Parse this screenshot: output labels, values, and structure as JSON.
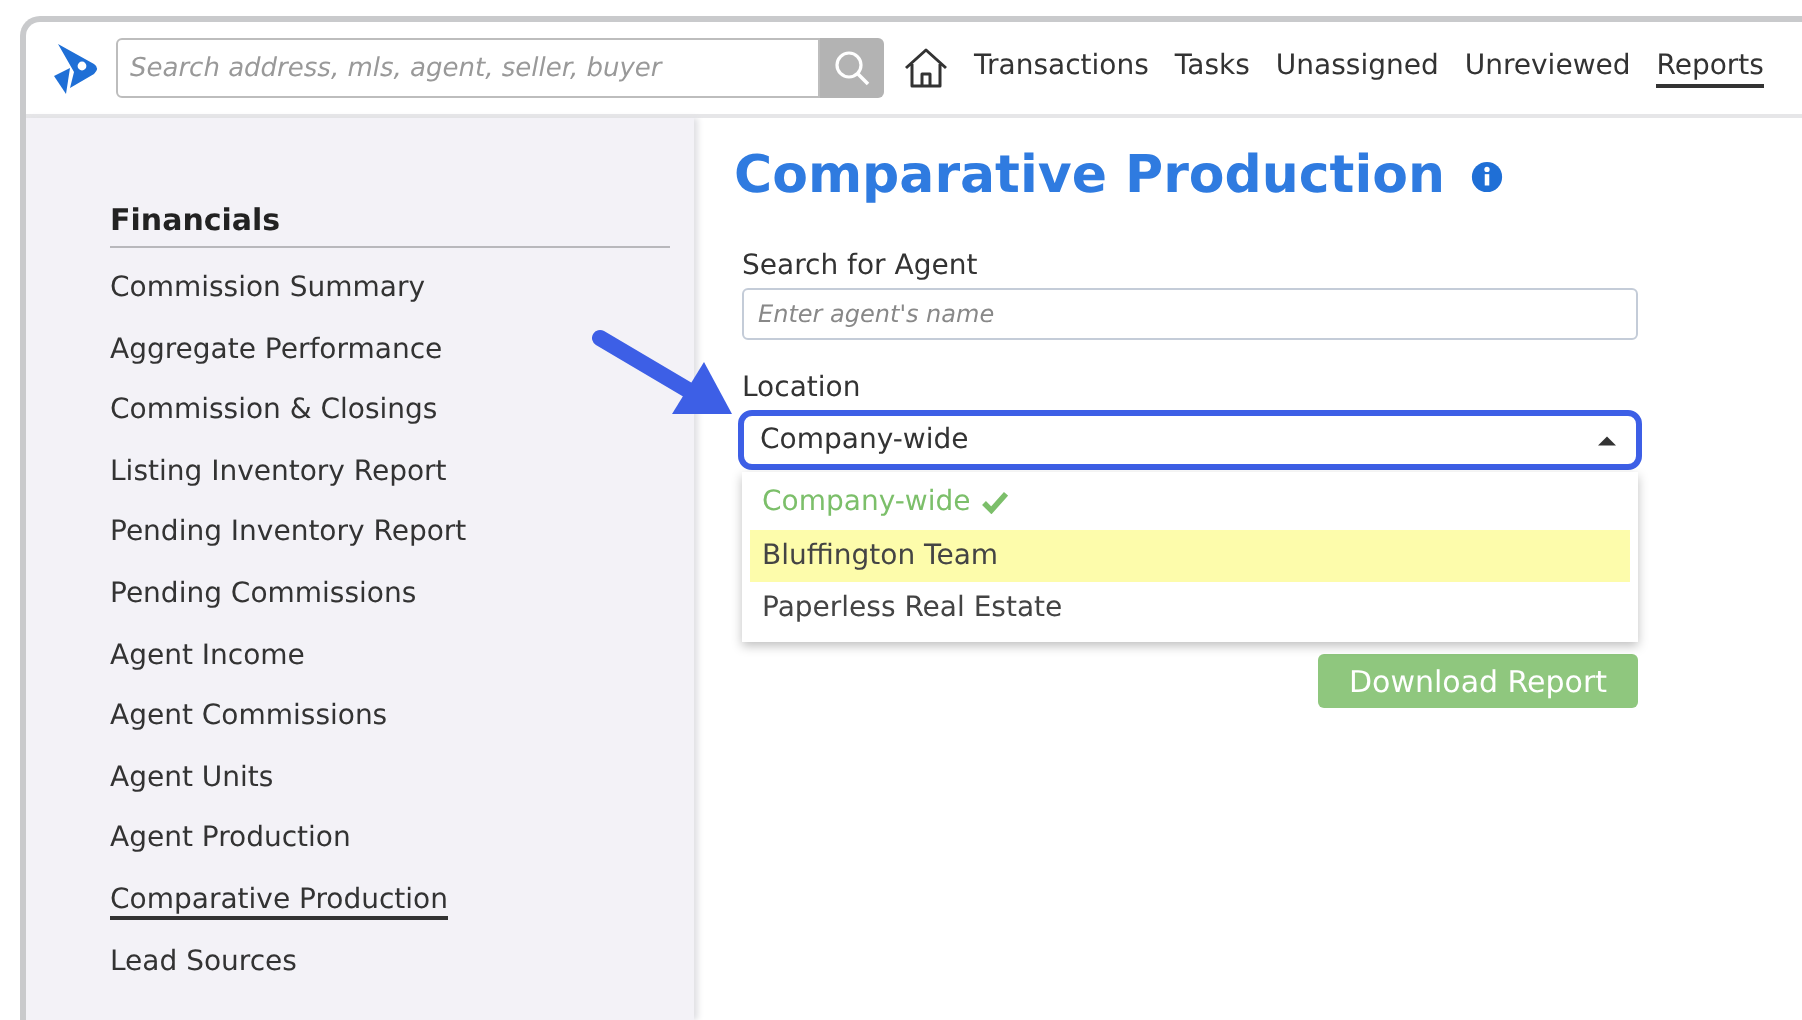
{
  "header": {
    "search": {
      "placeholder": "Search address, mls, agent, seller, buyer"
    },
    "nav": [
      {
        "label": "Transactions",
        "selected": false
      },
      {
        "label": "Tasks",
        "selected": false
      },
      {
        "label": "Unassigned",
        "selected": false
      },
      {
        "label": "Unreviewed",
        "selected": false
      },
      {
        "label": "Reports",
        "selected": true
      }
    ]
  },
  "sidebar": {
    "heading": "Financials",
    "items": [
      {
        "label": "Commission Summary",
        "selected": false
      },
      {
        "label": "Aggregate Performance",
        "selected": false
      },
      {
        "label": "Commission & Closings",
        "selected": false
      },
      {
        "label": "Listing Inventory Report",
        "selected": false
      },
      {
        "label": "Pending Inventory Report",
        "selected": false
      },
      {
        "label": "Pending Commissions",
        "selected": false
      },
      {
        "label": "Agent Income",
        "selected": false
      },
      {
        "label": "Agent Commissions",
        "selected": false
      },
      {
        "label": "Agent Units",
        "selected": false
      },
      {
        "label": "Agent Production",
        "selected": false
      },
      {
        "label": "Comparative Production",
        "selected": true
      },
      {
        "label": "Lead Sources",
        "selected": false
      }
    ]
  },
  "main": {
    "title": "Comparative Production",
    "agent_label": "Search for Agent",
    "agent_field": {
      "placeholder": "Enter agent's name"
    },
    "location_label": "Location",
    "location_select": {
      "value": "Company-wide",
      "expanded": true
    },
    "options": [
      {
        "label": "Company-wide",
        "selected": true,
        "highlighted": false
      },
      {
        "label": "Bluffington Team",
        "selected": false,
        "highlighted": true
      },
      {
        "label": "Paperless Real Estate",
        "selected": false,
        "highlighted": false
      }
    ],
    "download_button": "Download Report"
  }
}
